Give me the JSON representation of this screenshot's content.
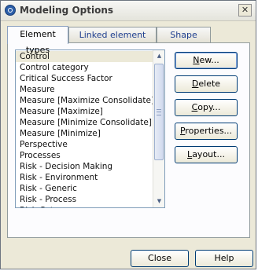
{
  "window": {
    "title": "Modeling Options",
    "close_glyph": "✕"
  },
  "tabs": [
    {
      "label": "Element types",
      "active": true
    },
    {
      "label": "Linked element types",
      "active": false
    },
    {
      "label": "Shape types",
      "active": false
    }
  ],
  "element_types": {
    "items": [
      "Control",
      "Control category",
      "Critical Success Factor",
      "Measure",
      "Measure [Maximize Consolidate]",
      "Measure [Maximize]",
      "Measure [Minimize Consolidate]",
      "Measure [Minimize]",
      "Perspective",
      "Processes",
      "Risk - Decision Making",
      "Risk - Environment",
      "Risk - Generic",
      "Risk - Process",
      "Risk Category"
    ],
    "selected": "Control"
  },
  "actions": {
    "new": {
      "label_u": "N",
      "label_rest": "ew..."
    },
    "delete": {
      "label_u": "D",
      "label_rest": "elete"
    },
    "copy": {
      "label_u": "C",
      "label_rest": "opy..."
    },
    "properties": {
      "label_u": "P",
      "label_rest": "roperties..."
    },
    "layout": {
      "label_u": "L",
      "label_rest": "ayout..."
    }
  },
  "footer": {
    "close_label": "Close",
    "help_label_u": "H",
    "help_label_rest": "elp"
  },
  "colors": {
    "tab_inactive_text": "#1f3f8f",
    "selected_row": "#ece9d8",
    "button_border": "#003c74"
  }
}
